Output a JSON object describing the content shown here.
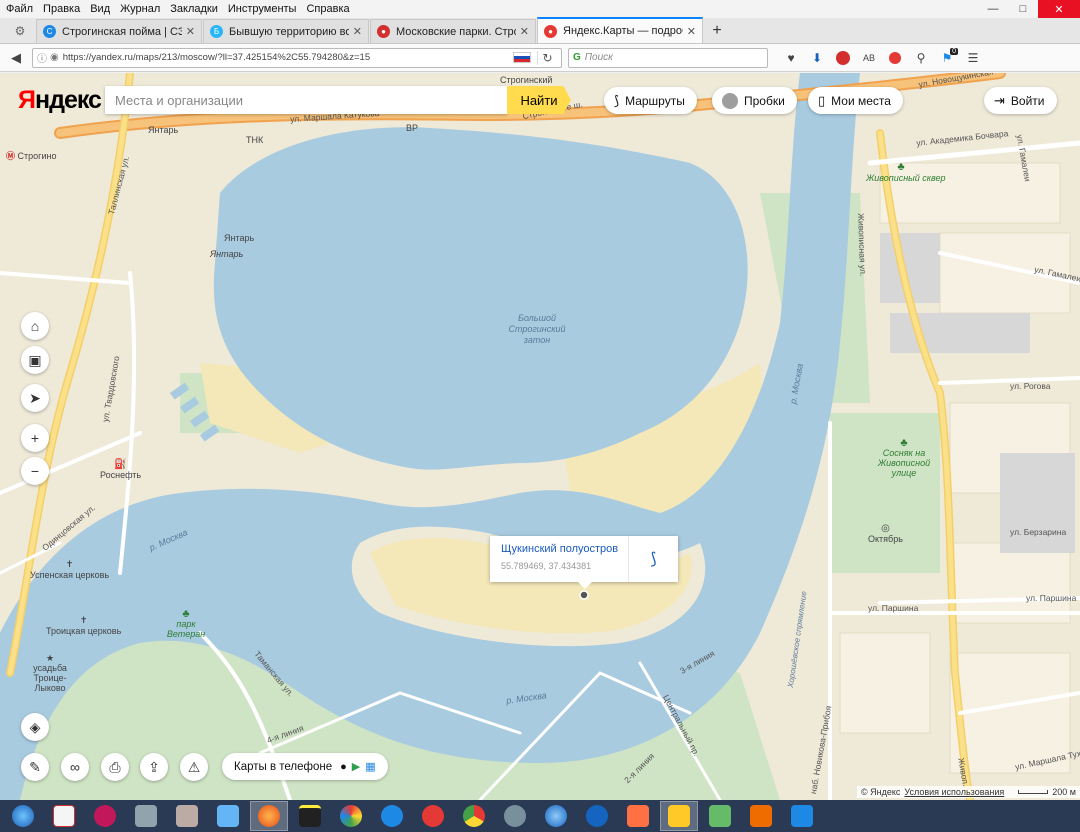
{
  "menu": {
    "items": [
      "Файл",
      "Правка",
      "Вид",
      "Журнал",
      "Закладки",
      "Инструменты",
      "Справка"
    ]
  },
  "window_controls": {
    "minimize": "—",
    "maximize": "□",
    "close": "✕"
  },
  "tabs": [
    {
      "title": "Строгинская пойма | СЗ...",
      "color": "#1e88e5",
      "active": false
    },
    {
      "title": "Бывшую территорию во...",
      "color": "#29b6f6",
      "active": false
    },
    {
      "title": "Московские парки. Стро...",
      "color": "#d32f2f",
      "active": false
    },
    {
      "title": "Яндекс.Карты — подроб...",
      "color": "#e53935",
      "active": true
    }
  ],
  "navbar": {
    "url": "https://yandex.ru/maps/213/moscow/?ll=37.425154%2C55.794280&z=15",
    "search_placeholder": "Поиск",
    "badge_count": "0",
    "ab_label": "AB"
  },
  "yandex": {
    "logo_letter": "Я",
    "logo_rest": "ндекс",
    "search_placeholder": "Места и организации",
    "search_button": "Найти",
    "routes_label": "Маршруты",
    "traffic_label": "Пробки",
    "places_label": "Мои места",
    "login_label": "Войти",
    "phone_label": "Карты в телефоне",
    "copyright": "© Яндекс",
    "terms": "Условия использования",
    "scale": "200 м"
  },
  "balloon": {
    "title": "Щукинский полуостров",
    "coords": "55.789469, 37.434381"
  },
  "map_labels": {
    "metro": "Строгино",
    "strogino_top": "Строгинский",
    "yantar_top": "Янтарь",
    "tnk": "ТНК",
    "bp": "BP",
    "katukova": "ул. Маршала Катукова",
    "stroginsky_sh": "Строгинское ш.",
    "novoshchukinskaya": "ул. Новощукинская",
    "bochkareva": "ул. Академика Бочвара",
    "gamalei_top": "ул. Гамалеи",
    "gamalei_right": "ул. Гамалеи",
    "zhivopisny_skver": "Живописный сквер",
    "zhivopisnaya_ul": "Живописная ул.",
    "yantar_mid": "Янтарь",
    "yantar_label": "Янтарь",
    "lake": "Большой Строгинский затон",
    "moskva_right": "р. Москва",
    "moskva_left": "р. Москва",
    "moskva_bottom": "р. Москва",
    "rogova": "ул. Рогова",
    "sosnyak": "Сосняк на Живописной улице",
    "oktyabr": "Октябрь",
    "berzarina": "ул. Берзарина",
    "parshina": "ул. Паршина",
    "parshina_right": "ул. Паршина",
    "twardovskogo": "ул. Твардовского",
    "tallinskaya": "Таллинская ул.",
    "rosneft": "Роснефть",
    "odintsovskaya": "Одинцовская ул.",
    "uspenskaya": "Успенская церковь",
    "troitskaya": "Троицкая церковь",
    "usadba": "усадьба Троице-Лыково",
    "park_veteran": "парк Ветеран",
    "tamanskaya": "Таманская ул.",
    "line3": "3-я линия",
    "line4": "4-я линия",
    "line2": "2-я линия",
    "centr_pr": "Центральный пр.",
    "novikova": "наб. Новикова-Прибоя",
    "marshala_tuhach": "ул. Маршала Тухачевского",
    "zhivop_bottom": "Живоп.",
    "khoroshevo": "Хорошёвское спрямление"
  },
  "colors": {
    "water": "#a8cbe0",
    "land": "#efe9d8",
    "sand": "#f4e8b8",
    "park": "#cfe4c5",
    "road_orange": "#f7b76b",
    "road_yellow": "#fbe08a",
    "accent_yellow": "#ffdb4d",
    "link_blue": "#1a5bbd"
  }
}
